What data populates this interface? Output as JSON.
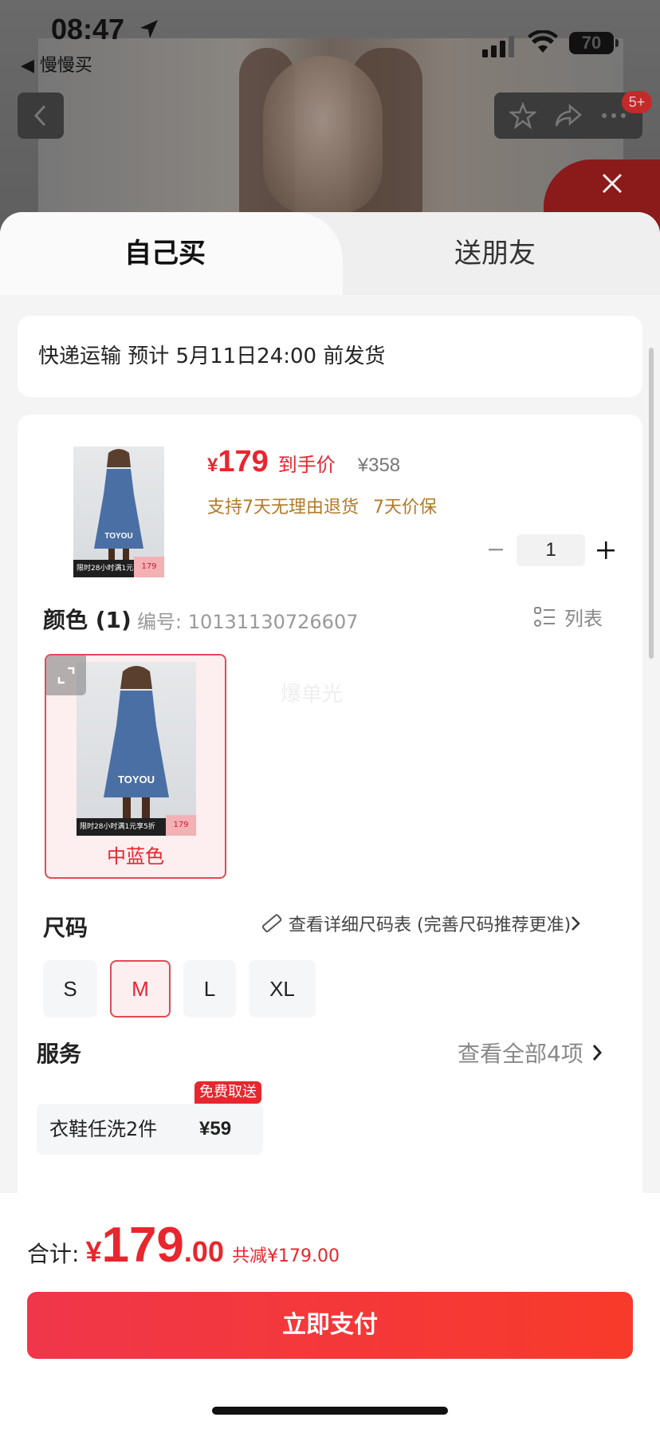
{
  "status_bar": {
    "time": "08:47",
    "back_app": "◀ 慢慢买",
    "battery": "70"
  },
  "nav": {
    "badge": "5+"
  },
  "tabs": [
    {
      "label": "自己买",
      "active": true
    },
    {
      "label": "送朋友",
      "active": false
    }
  ],
  "shipping": {
    "text": "快递运输 预计 5月11日24:00 前发货"
  },
  "product": {
    "currency": "¥",
    "price": "179",
    "price_label": "到手价",
    "original_price": "¥358",
    "guarantees": [
      "支持7天无理由退货",
      "7天价保"
    ],
    "quantity": "1",
    "thumb_brand": "TOYOU",
    "thumb_promo": "限时28小时满1元享5折",
    "thumb_price": "179"
  },
  "color": {
    "heading": "颜色 (1)",
    "code": "编号: 10131130726607",
    "list_label": "列表",
    "options": [
      {
        "label": "中蓝色",
        "selected": true
      }
    ],
    "watermark": "爆单光"
  },
  "size": {
    "heading": "尺码",
    "guide": "查看详细尺码表 (完善尺码推荐更准)",
    "options": [
      {
        "label": "S",
        "selected": false
      },
      {
        "label": "M",
        "selected": true
      },
      {
        "label": "L",
        "selected": false
      },
      {
        "label": "XL",
        "selected": false
      }
    ]
  },
  "service": {
    "heading": "服务",
    "view_all": "查看全部4项",
    "item": {
      "name": "衣鞋任洗2件",
      "price": "¥59",
      "badge": "免费取送"
    }
  },
  "footer": {
    "total_label": "合计:",
    "currency": "¥",
    "total_int": "179",
    "total_dec": ".00",
    "discount": "共减¥179.00",
    "pay_button": "立即支付"
  },
  "colors": {
    "accent": "#e8262d",
    "gold": "#b07a29",
    "selected_bg": "#fdeef0"
  }
}
